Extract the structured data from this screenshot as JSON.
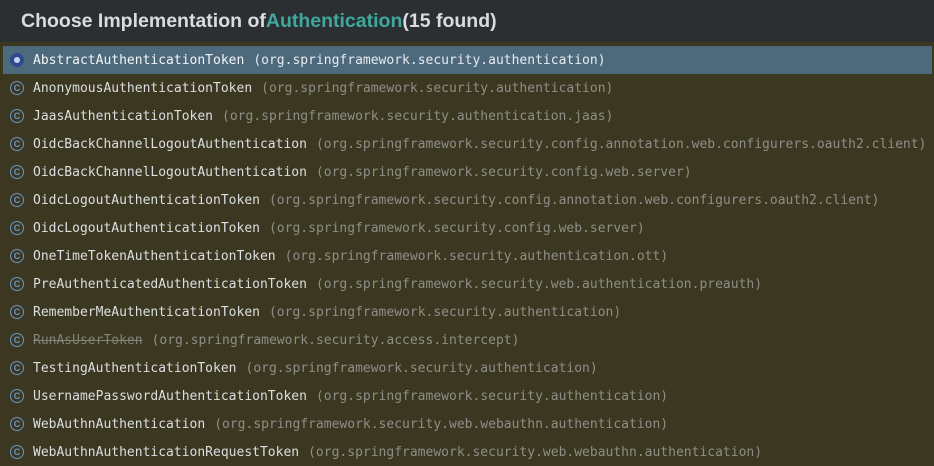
{
  "header": {
    "prefix": "Choose Implementation of ",
    "target": "Authentication",
    "suffix": " (15 found)"
  },
  "colors": {
    "background": "#3b3721",
    "header_background": "#2c2f32",
    "accent": "#3fa89e",
    "selection": "#4d6a7d"
  },
  "items": [
    {
      "name": "AbstractAuthenticationToken",
      "package": "(org.springframework.security.authentication)",
      "icon": "abstract-class-icon",
      "selected": true,
      "deprecated": false
    },
    {
      "name": "AnonymousAuthenticationToken",
      "package": "(org.springframework.security.authentication)",
      "icon": "class-icon",
      "selected": false,
      "deprecated": false
    },
    {
      "name": "JaasAuthenticationToken",
      "package": "(org.springframework.security.authentication.jaas)",
      "icon": "class-icon",
      "selected": false,
      "deprecated": false
    },
    {
      "name": "OidcBackChannelLogoutAuthentication",
      "package": "(org.springframework.security.config.annotation.web.configurers.oauth2.client)",
      "icon": "class-icon",
      "selected": false,
      "deprecated": false
    },
    {
      "name": "OidcBackChannelLogoutAuthentication",
      "package": "(org.springframework.security.config.web.server)",
      "icon": "class-icon",
      "selected": false,
      "deprecated": false
    },
    {
      "name": "OidcLogoutAuthenticationToken",
      "package": "(org.springframework.security.config.annotation.web.configurers.oauth2.client)",
      "icon": "class-icon",
      "selected": false,
      "deprecated": false
    },
    {
      "name": "OidcLogoutAuthenticationToken",
      "package": "(org.springframework.security.config.web.server)",
      "icon": "class-icon",
      "selected": false,
      "deprecated": false
    },
    {
      "name": "OneTimeTokenAuthenticationToken",
      "package": "(org.springframework.security.authentication.ott)",
      "icon": "class-icon",
      "selected": false,
      "deprecated": false
    },
    {
      "name": "PreAuthenticatedAuthenticationToken",
      "package": "(org.springframework.security.web.authentication.preauth)",
      "icon": "class-icon",
      "selected": false,
      "deprecated": false
    },
    {
      "name": "RememberMeAuthenticationToken",
      "package": "(org.springframework.security.authentication)",
      "icon": "class-icon",
      "selected": false,
      "deprecated": false
    },
    {
      "name": "RunAsUserToken",
      "package": "(org.springframework.security.access.intercept)",
      "icon": "class-icon",
      "selected": false,
      "deprecated": true
    },
    {
      "name": "TestingAuthenticationToken",
      "package": "(org.springframework.security.authentication)",
      "icon": "class-icon",
      "selected": false,
      "deprecated": false
    },
    {
      "name": "UsernamePasswordAuthenticationToken",
      "package": "(org.springframework.security.authentication)",
      "icon": "class-icon",
      "selected": false,
      "deprecated": false
    },
    {
      "name": "WebAuthnAuthentication",
      "package": "(org.springframework.security.web.webauthn.authentication)",
      "icon": "class-icon",
      "selected": false,
      "deprecated": false
    },
    {
      "name": "WebAuthnAuthenticationRequestToken",
      "package": "(org.springframework.security.web.webauthn.authentication)",
      "icon": "class-icon",
      "selected": false,
      "deprecated": false
    }
  ]
}
